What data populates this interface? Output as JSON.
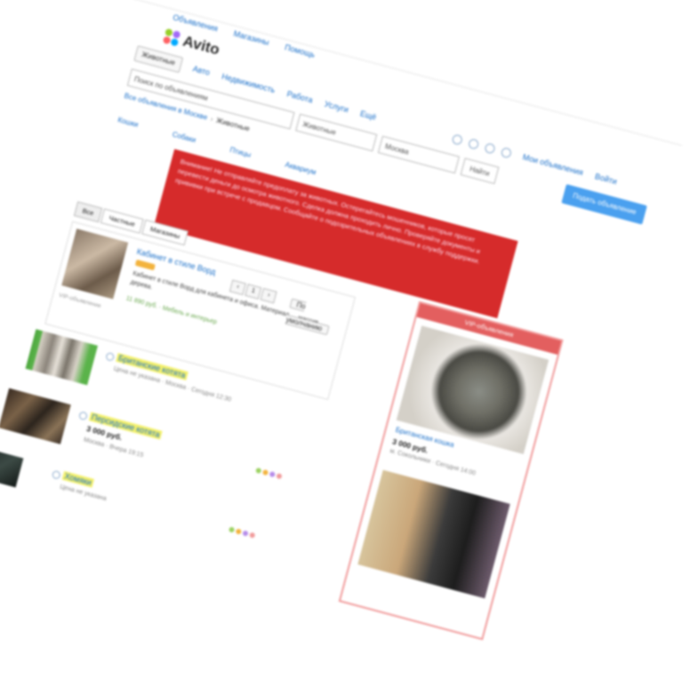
{
  "topnav": [
    "Объявления",
    "Магазины",
    "Помощь"
  ],
  "logo": "Avito",
  "catnav": {
    "category": "Животные",
    "links": [
      "Авто",
      "Недвижимость",
      "Работа",
      "Услуги",
      "Ещё"
    ],
    "account": "Мои объявления",
    "login": "Войти"
  },
  "search": {
    "placeholder": "Поиск по объявлениям",
    "category": "Животные",
    "region": "Москва",
    "button": "Подать объявление",
    "find": "Найти"
  },
  "crumbs": {
    "all": "Все объявления в Москве",
    "current": "Животные"
  },
  "filters": [
    "Кошки",
    "Собаки",
    "Птицы",
    "Аквариум"
  ],
  "banner_text": "Внимание! Не отправляйте предоплату за животных. Остерегайтесь мошенников, которые просят перевести деньги до осмотра животного. Сделка должна проходить лично. Проверяйте документы и прививки при встрече с продавцом. Сообщайте о подозрительных объявлениях в службу поддержки.",
  "tabs": [
    "Все",
    "Частные",
    "Магазины"
  ],
  "vip": {
    "title": "Кабинет в стиле Ворд",
    "desc": "Кабинет в стиле Ворд для кабинета и офиса. Материал — массив дерева.",
    "price": "11 890 руб.",
    "meta": "Мебель и интерьер",
    "foot": "VIP-объявление",
    "pager": [
      "‹",
      "1",
      "›"
    ],
    "sort": "По умолчанию"
  },
  "items": [
    {
      "title": "Британские котята",
      "price": "",
      "meta": "Цена не указана · Москва · Сегодня 12:30"
    },
    {
      "title": "Персидские котята",
      "price": "3 000 руб.",
      "meta": "Москва · Вчера 19:15"
    },
    {
      "title": "Хомяки",
      "price": "",
      "meta": "Цена не указана"
    }
  ],
  "aside": {
    "head": "VIP-объявления",
    "title": "Британская кошка",
    "price": "3 000 руб.",
    "meta": "м. Сокольники · Сегодня 14:00"
  },
  "colors": {
    "accent": "#1a6fc9",
    "banner": "#d62b2b",
    "button": "#4aa0ef",
    "highlight": "#f3f06a"
  }
}
